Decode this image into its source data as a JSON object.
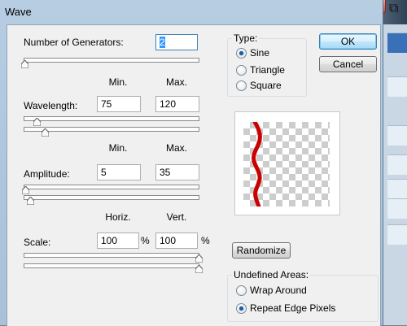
{
  "dialog": {
    "title": "Wave"
  },
  "generators": {
    "label": "Number of Generators:",
    "value": "2"
  },
  "columns": {
    "min": "Min.",
    "max": "Max.",
    "horiz": "Horiz.",
    "vert": "Vert."
  },
  "wavelength": {
    "label": "Wavelength:",
    "min": "75",
    "max": "120"
  },
  "amplitude": {
    "label": "Amplitude:",
    "min": "5",
    "max": "35"
  },
  "scale": {
    "label": "Scale:",
    "horiz": "100",
    "vert": "100",
    "unit": "%"
  },
  "type_group": {
    "title": "Type:",
    "options": [
      {
        "label": "Sine",
        "selected": true
      },
      {
        "label": "Triangle",
        "selected": false
      },
      {
        "label": "Square",
        "selected": false
      }
    ]
  },
  "buttons": {
    "ok": "OK",
    "cancel": "Cancel",
    "randomize": "Randomize"
  },
  "undefined_areas": {
    "title": "Undefined Areas:",
    "options": [
      {
        "label": "Wrap Around",
        "selected": false
      },
      {
        "label": "Repeat Edge Pixels",
        "selected": true
      }
    ]
  },
  "colors": {
    "wave_stroke": "#cc0000",
    "accent": "#3c7fb1",
    "radio_dot": "#1b5ea8"
  },
  "icons": {
    "window_close": "close-icon"
  }
}
